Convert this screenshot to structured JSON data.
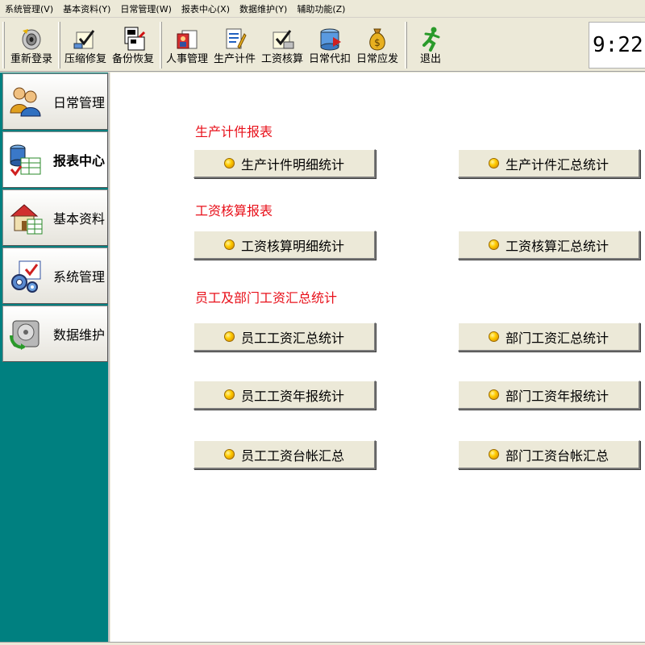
{
  "menu": [
    "系统管理(V)",
    "基本资料(Y)",
    "日常管理(W)",
    "报表中心(X)",
    "数据维护(Y)",
    "辅助功能(Z)"
  ],
  "toolbar": {
    "relogin": "重新登录",
    "compress": "压缩修复",
    "backup": "备份恢复",
    "personnel": "人事管理",
    "piecework": "生产计件",
    "salary": "工资核算",
    "deduct": "日常代扣",
    "payable": "日常应发",
    "exit": "退出",
    "clock": "9:22:"
  },
  "sidebar": {
    "daily": "日常管理",
    "reports": "报表中心",
    "basic": "基本资料",
    "system": "系统管理",
    "data": "数据维护"
  },
  "content": {
    "sec_piece": "生产计件报表",
    "btn_piece_detail": "生产计件明细统计",
    "btn_piece_summary": "生产计件汇总统计",
    "sec_salary": "工资核算报表",
    "btn_salary_detail": "工资核算明细统计",
    "btn_salary_summary": "工资核算汇总统计",
    "sec_staff": "员工及部门工资汇总统计",
    "btn_staff_summary": "员工工资汇总统计",
    "btn_dept_summary": "部门工资汇总统计",
    "btn_staff_year": "员工工资年报统计",
    "btn_dept_year": "部门工资年报统计",
    "btn_staff_ledger": "员工工资台帐汇总",
    "btn_dept_ledger": "部门工资台帐汇总"
  },
  "colors": {
    "sidebar_bg": "#008080",
    "section_title": "#e8101a",
    "window_bg": "#ece9d8"
  }
}
